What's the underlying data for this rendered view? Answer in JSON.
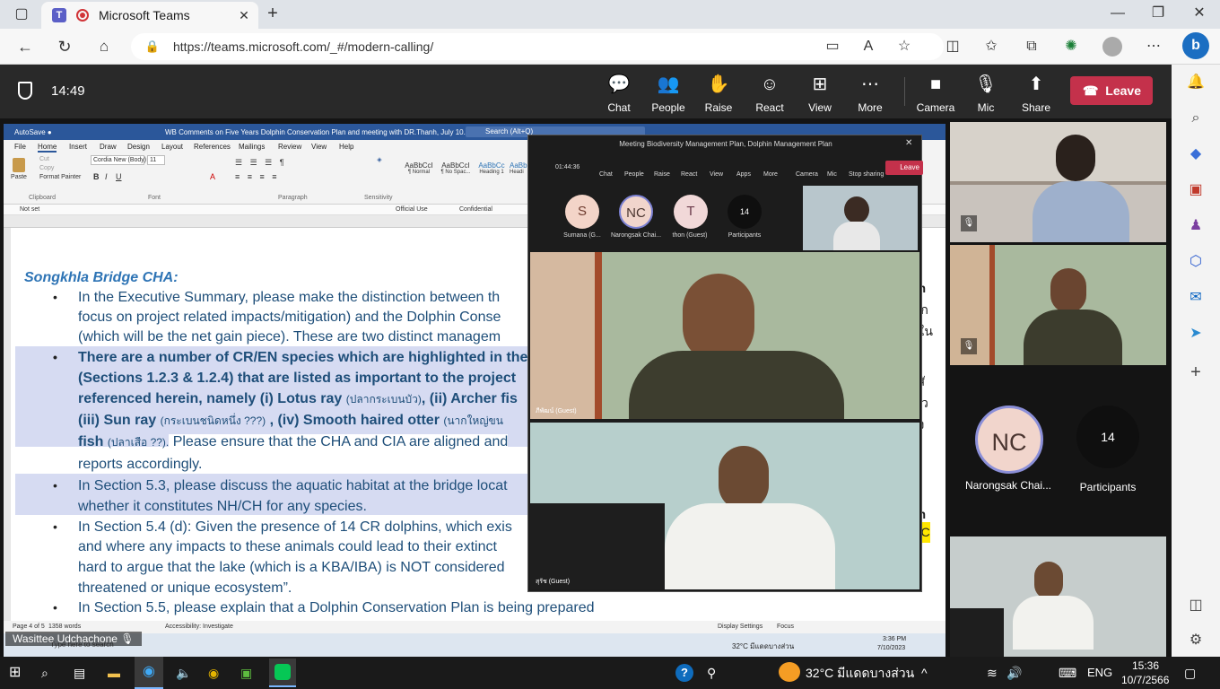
{
  "browser": {
    "tab_title": "Microsoft Teams",
    "url": "https://teams.microsoft.com/_#/modern-calling/"
  },
  "teams": {
    "timer": "14:49",
    "controls": [
      "Chat",
      "People",
      "Raise",
      "React",
      "View",
      "More"
    ],
    "camera": "Camera",
    "mic": "Mic",
    "share": "Share",
    "leave": "Leave"
  },
  "word": {
    "title": "WB Comments on Five Years Dolphin Conservation Plan and meeting with DR.Thanh, July 10.docx • Saved",
    "search": "Search (Alt+Q)",
    "user": "Wasittee Udchachone",
    "menu": [
      "File",
      "Home",
      "Insert",
      "Draw",
      "Design",
      "Layout",
      "References",
      "Mailings",
      "Review",
      "View",
      "Help"
    ],
    "sensitivity": "Not set",
    "labels": [
      "Official Use",
      "Confidential"
    ],
    "ribbon": {
      "font": "Cordia New (Body)",
      "size": "11",
      "groups": [
        "Clipboard",
        "Font",
        "Paragraph",
        "Sensitivity"
      ],
      "styles": [
        "AaBbCcI",
        "AaBbCcI",
        "AaBbCc",
        "AaBbCc"
      ],
      "style_names": [
        "¶ Normal",
        "¶ No Spac...",
        "Heading 1",
        "Headi"
      ],
      "paste": "Paste",
      "format_painter": "Format Painter",
      "cut": "Cut",
      "copy": "Copy"
    },
    "status": {
      "page": "Page 4 of 5",
      "words": "1358 words",
      "accessibility": "Accessibility: Investigate",
      "display": "Display Settings",
      "focus": "Focus"
    }
  },
  "doc": {
    "heading": "Songkhla Bridge CHA:",
    "l1": "In the Executive Summary, please make the distinction between th",
    "l2": "focus on project related impacts/mitigation) and the Dolphin Conse",
    "l3": "(which will be the net gain piece). These are two distinct managem",
    "l4": "There are a number of CR/EN species which are highlighted in the",
    "l5": "(Sections 1.2.3 & 1.2.4) that are listed as important to the project",
    "l6a": "referenced herein, namely (i) Lotus ray ",
    "l6b": "(ปลากระเบนบัว)",
    "l6c": ", (ii) Archer fis",
    "l7a": "(iii) Sun ray ",
    "l7b": "(กระเบนชนิดหนึ่ง ???)",
    "l7c": " , (iv) Smooth haired otter ",
    "l7d": "(นากใหญ่ขน",
    "l8a": "fish ",
    "l8b": "(ปลาเสือ ??).",
    "l8c": " Please ensure that the CHA and CIA are aligned and",
    "l9": "reports accordingly.",
    "l10": "In Section 5.3, please discuss the aquatic habitat at the bridge locat",
    "l11": "whether it constitutes NH/CH for any species.",
    "l12": "In Section 5.4 (d): Given the presence of 14 CR dolphins, which exis",
    "l13": "and where any impacts to these animals could lead to their extinct",
    "l14": "hard to argue that the lake (which is a KBA/IBA) is NOT considered",
    "l15": "threatened or unique ecosystem”.",
    "l16": "In Section 5.5, please explain that a Dolphin Conservation Plan is being prepared",
    "bullet": "•",
    "r1": "on",
    "r2": "ะ ก",
    "r3": "กใน",
    "r4": "รสั",
    "r5": "ว",
    "r6": "สง",
    "r7": "on",
    "r8": "MC"
  },
  "inner_meeting": {
    "title": "Meeting Biodiversity Management Plan, Dolphin Management Plan",
    "timer": "01:44:36",
    "controls": [
      "Chat",
      "People",
      "Raise",
      "React",
      "View",
      "Apps",
      "More",
      "Camera",
      "Mic",
      "Stop sharing"
    ],
    "leave": "Leave",
    "participants": [
      {
        "initials": "S",
        "name": "Sumana (G..."
      },
      {
        "initials": "NC",
        "name": "Narongsak Chai..."
      },
      {
        "initials": "T",
        "name": "thon (Guest)"
      },
      {
        "initials": "14",
        "name": "Participants"
      }
    ],
    "video1": "ภีพัฒน์ (Guest)",
    "video2": "สุรัช (Guest)"
  },
  "side": {
    "nc_initials": "NC",
    "nc_name": "Narongsak Chai...",
    "participants_count": "14",
    "participants_label": "Participants"
  },
  "presenter": "Wasittee Udchachone",
  "inner_tray": {
    "weather": "32°C มีแดดบางส่วน",
    "time": "3:36 PM",
    "date": "7/10/2023",
    "search": "Type here to search"
  },
  "taskbar": {
    "weather": "32°C มีแดดบางส่วน",
    "lang": "ENG",
    "time": "15:36",
    "date": "10/7/2566"
  },
  "colors": {
    "leave": "#c4314b",
    "word_blue": "#2b579a",
    "highlight": "#d6dbf2"
  }
}
